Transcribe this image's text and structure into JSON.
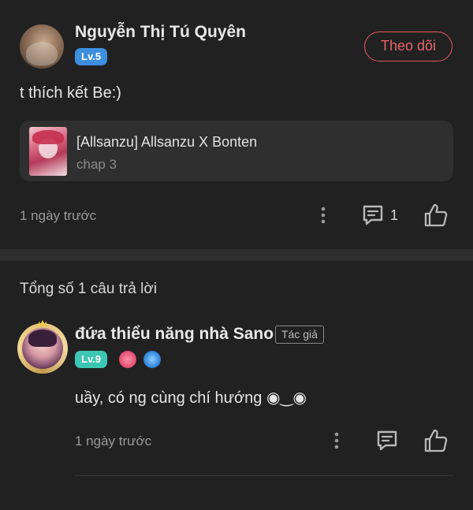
{
  "comment": {
    "username": "Nguyễn Thị Tú Quyên",
    "level": "Lv.5",
    "follow_label": "Theo dõi",
    "text": "t thích kết Be:)",
    "story": {
      "title": "[Allsanzu] Allsanzu X Bonten",
      "chapter": "chap 3"
    },
    "time": "1 ngày trước",
    "comment_count": "1",
    "icons": {
      "more": "more-vertical-icon",
      "comment": "comment-icon",
      "like": "thumbs-up-icon"
    }
  },
  "replies": {
    "header": "Tổng số 1 câu trả lời",
    "items": [
      {
        "username": "đứa thiểu năng nhà Sano",
        "author_tag": "Tác giả",
        "level": "Lv.9",
        "text": "uầy, có ng cùng chí hướng ◉‿◉",
        "time": "1 ngày trước"
      }
    ]
  },
  "colors": {
    "background": "#212121",
    "card": "#2f2f2f",
    "follow_accent": "#e25a5f",
    "level5": "#3d8fe0",
    "level9": "#3ec6b4"
  }
}
